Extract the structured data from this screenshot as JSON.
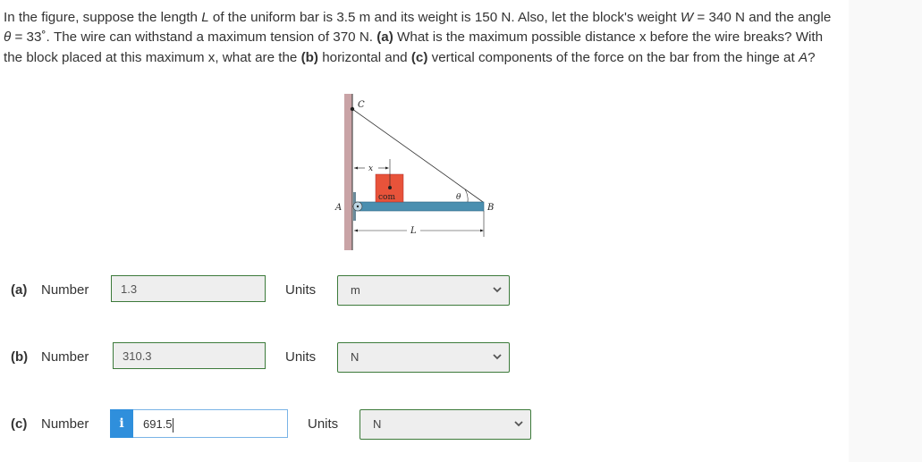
{
  "question": {
    "segments": [
      {
        "t": "In the figure, suppose the length "
      },
      {
        "t": "L",
        "style": "i"
      },
      {
        "t": " of the uniform bar is 3.5 m and its weight is 150 N. Also, let the block's weight "
      },
      {
        "t": "W",
        "style": "i"
      },
      {
        "t": " = 340 N and the angle "
      },
      {
        "t": "θ",
        "style": "i"
      },
      {
        "t": " = 33˚. The wire can withstand a maximum tension of 370 N. "
      },
      {
        "t": "(a)",
        "style": "b"
      },
      {
        "t": " What is the maximum possible distance x before the wire breaks? With the block placed at this maximum x, what are the "
      },
      {
        "t": "(b)",
        "style": "b"
      },
      {
        "t": " horizontal and "
      },
      {
        "t": "(c)",
        "style": "b"
      },
      {
        "t": " vertical components of the force on the bar from the hinge at "
      },
      {
        "t": "A",
        "style": "i"
      },
      {
        "t": "?"
      }
    ]
  },
  "figure": {
    "labels": {
      "C": "C",
      "A": "A",
      "B": "B",
      "x": "x",
      "L": "L",
      "theta": "θ",
      "com": "com"
    },
    "colors": {
      "wall": "#c9a3a6",
      "bar": "#4a8fb0",
      "block": "#e8533a",
      "wire": "#333333"
    }
  },
  "answers": [
    {
      "part": "(a)",
      "number_label": "Number",
      "value": "1.3",
      "units_label": "Units",
      "unit": "m",
      "active": false
    },
    {
      "part": "(b)",
      "number_label": "Number",
      "value": "310.3",
      "units_label": "Units",
      "unit": "N",
      "active": false
    },
    {
      "part": "(c)",
      "number_label": "Number",
      "value": "691.5",
      "units_label": "Units",
      "unit": "N",
      "active": true,
      "info_icon": "i"
    }
  ],
  "colors": {
    "correct_border": "#3c7a3a",
    "active_border": "#7ab3e6",
    "info_badge": "#2f8fdc"
  }
}
